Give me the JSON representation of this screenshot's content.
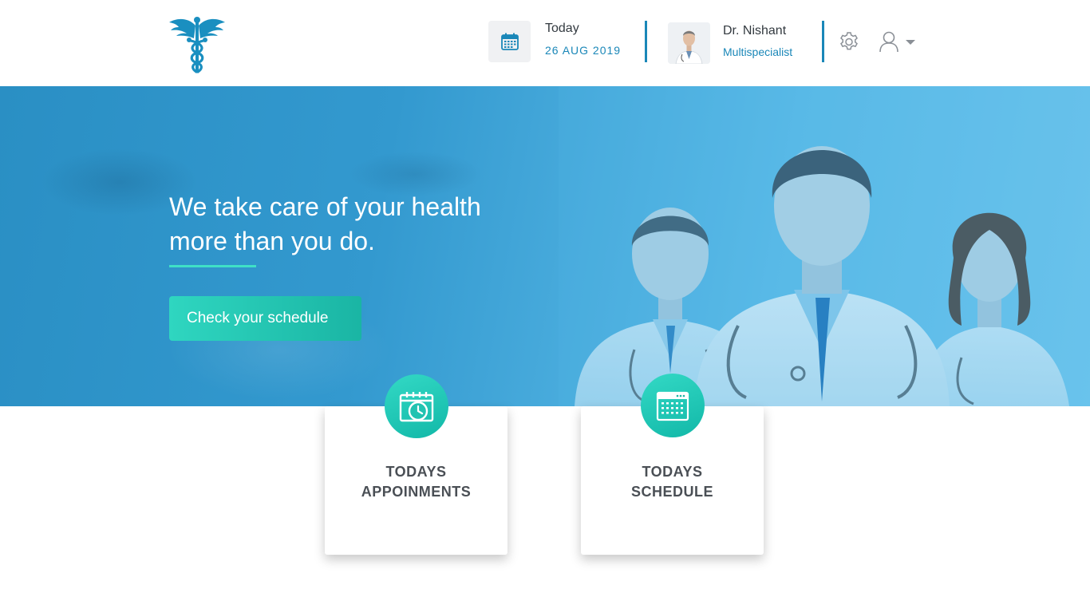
{
  "header": {
    "date_label": "Today",
    "date_value": "26 AUG 2019",
    "doctor_name": "Dr. Nishant",
    "doctor_role": "Multispecialist"
  },
  "hero": {
    "title_line1": "We take care of your health",
    "title_line2": "more than you do.",
    "cta_label": "Check your schedule"
  },
  "cards": [
    {
      "line1": "TODAYS",
      "line2": "APPOINMENTS",
      "icon": "calendar-clock-icon"
    },
    {
      "line1": "TODAYS",
      "line2": "SCHEDULE",
      "icon": "calendar-grid-icon"
    }
  ],
  "colors": {
    "accent_blue": "#1a87b8",
    "teal": "#1ab5a4",
    "hero_blue": "#3399cf"
  }
}
